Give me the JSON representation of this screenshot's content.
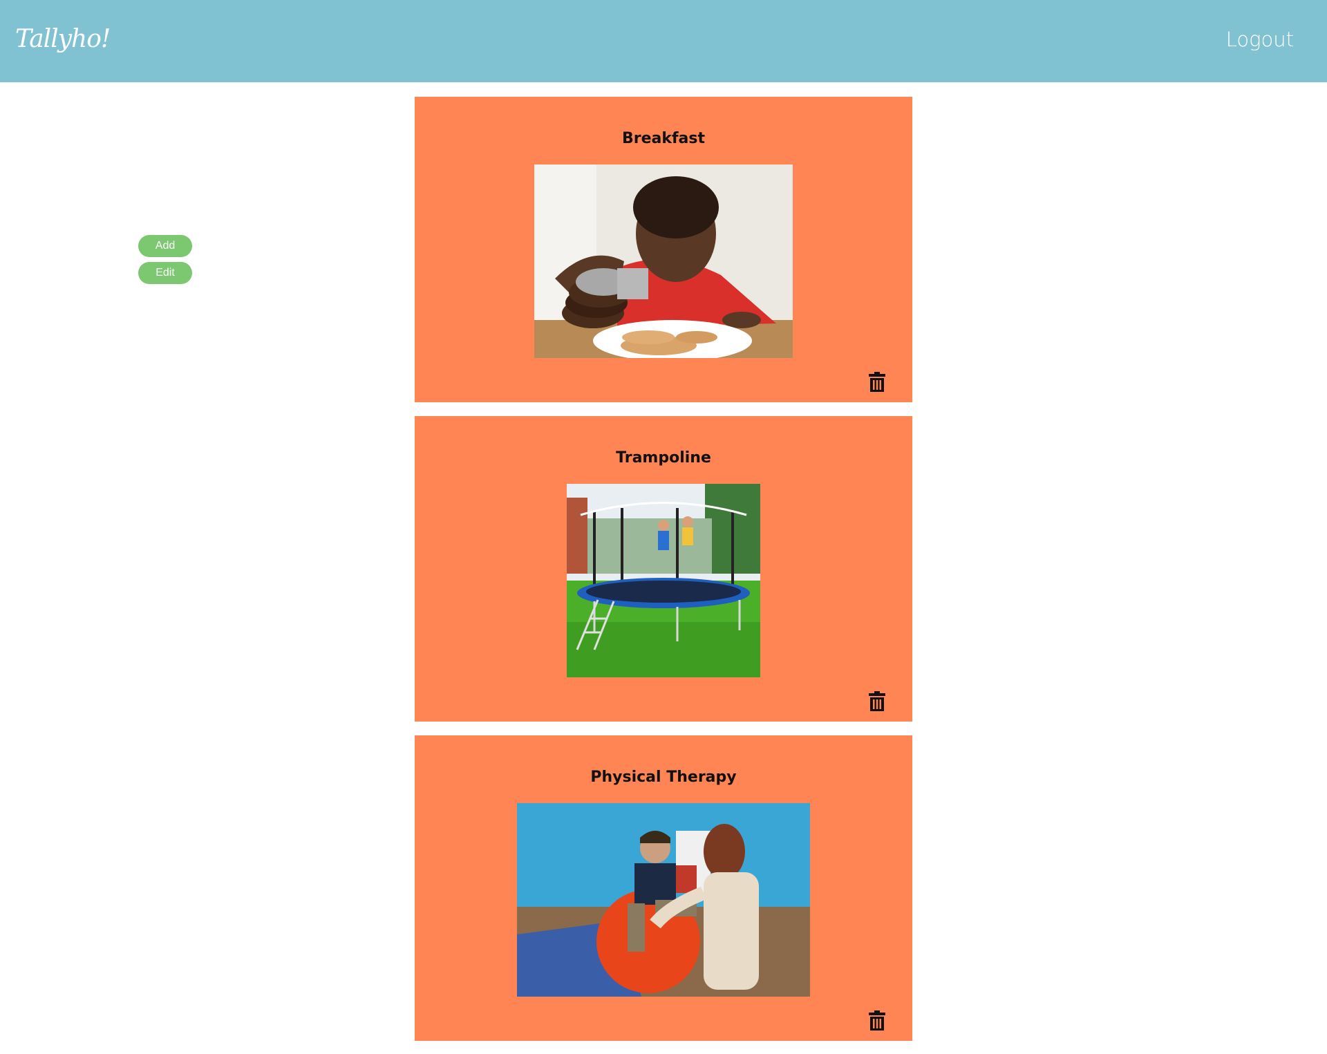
{
  "header": {
    "logo_text": "Tallyho!",
    "logout_label": "Logout"
  },
  "sidebar": {
    "add_label": "Add",
    "edit_label": "Edit"
  },
  "activities": [
    {
      "title": "Breakfast",
      "image": "child pouring syrup on pancakes"
    },
    {
      "title": "Trampoline",
      "image": "children jumping on backyard trampoline"
    },
    {
      "title": "Physical Therapy",
      "image": "child on therapy ball with therapist"
    }
  ],
  "colors": {
    "header_bg": "#80c2d1",
    "card_bg": "#ff8555",
    "button_bg": "#7cc870"
  },
  "icons": {
    "delete": "trash-icon"
  }
}
